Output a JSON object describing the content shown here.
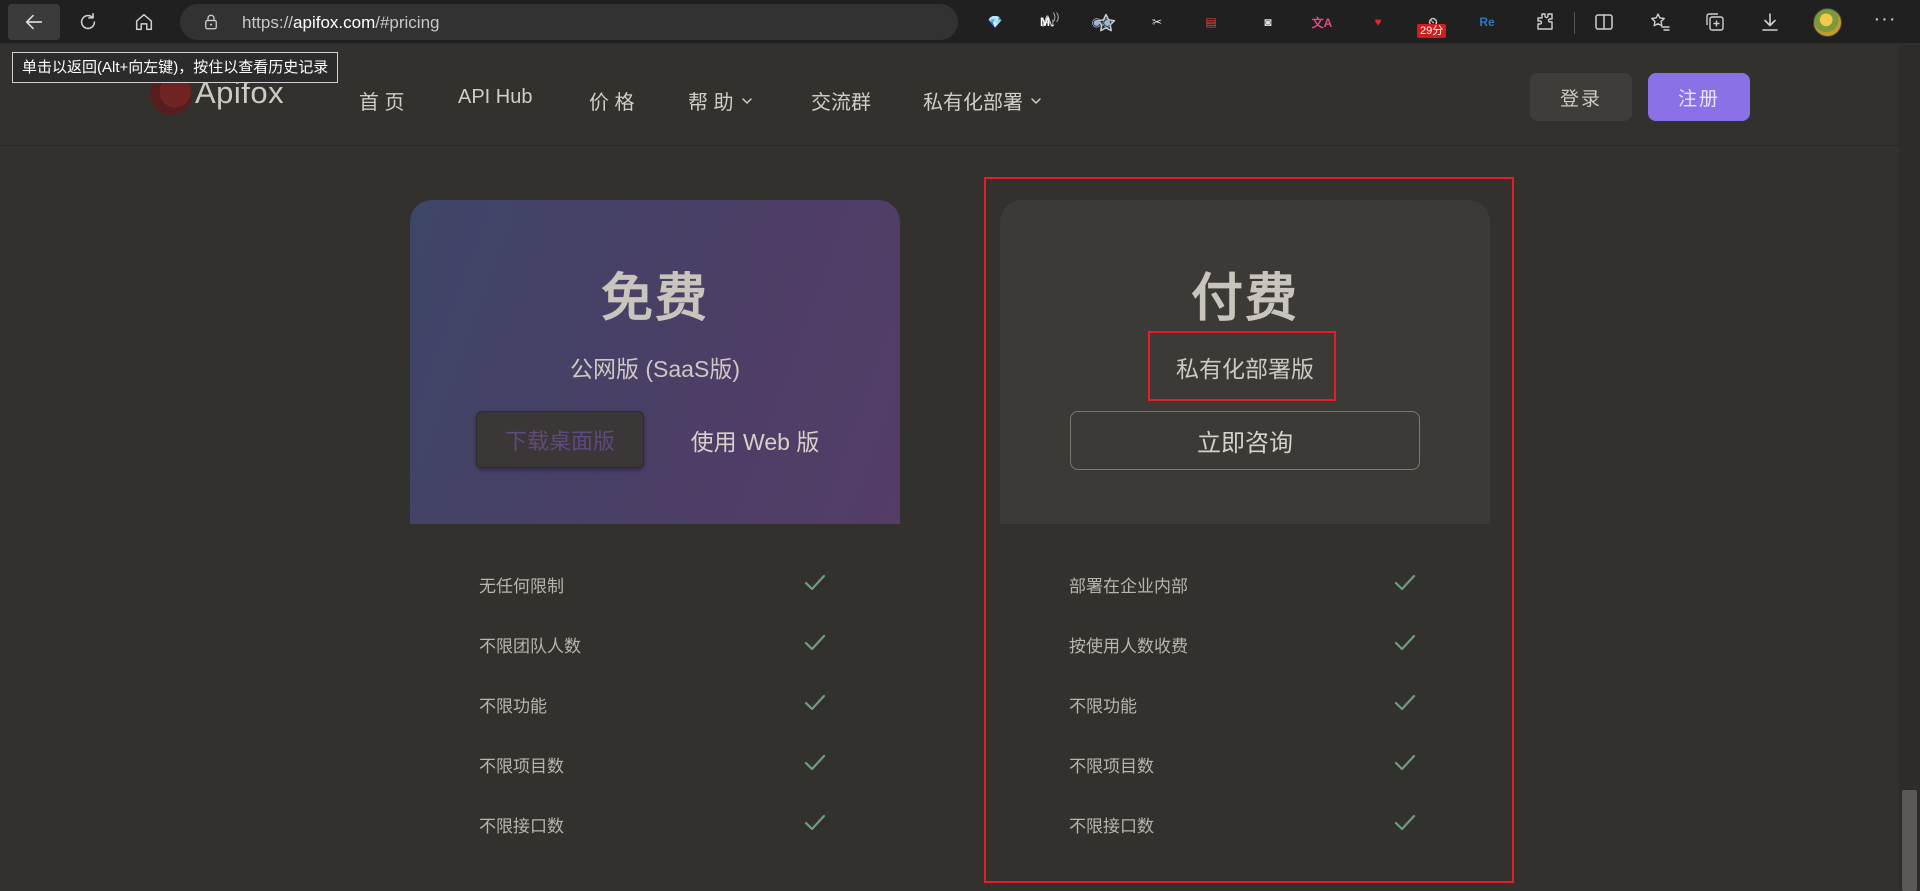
{
  "browser": {
    "url_prefix": "https://",
    "url_host": "apifox.com",
    "url_path": "/#pricing",
    "tooltip": "单击以返回(Alt+向左键)，按住以查看历史记录",
    "extensions": [
      {
        "name": "gem-extension-icon",
        "text": "💎",
        "color": "#3fa7ff"
      },
      {
        "name": "markdown-extension-icon",
        "text": "M↓",
        "color": "#ffffff"
      },
      {
        "name": "glasses-face-extension-icon",
        "text": "◉◉",
        "color": "#9fb6d6"
      },
      {
        "name": "scissors-extension-icon",
        "text": "✂",
        "color": "#e0e0e0"
      },
      {
        "name": "notes-extension-icon",
        "text": "▤",
        "color": "#e5473b"
      },
      {
        "name": "mask-extension-icon",
        "text": "◙",
        "color": "#dedede"
      },
      {
        "name": "translate-extension-icon",
        "text": "文A",
        "color": "#e24a8b"
      },
      {
        "name": "heart-shield-extension-icon",
        "text": "♥",
        "color": "#e0242c"
      },
      {
        "name": "timer-extension-icon",
        "text": "⏲",
        "color": "#c9c9c9"
      },
      {
        "name": "resume-extension-icon",
        "text": "Re",
        "color": "#2b79c2"
      }
    ],
    "timer_badge": "29分"
  },
  "header": {
    "logo_text": "Apifox",
    "nav": [
      {
        "label": "首 页"
      },
      {
        "label": "API Hub"
      },
      {
        "label": "价 格"
      },
      {
        "label": "帮 助"
      },
      {
        "label": "交流群"
      },
      {
        "label": "私有化部署"
      }
    ],
    "login_label": "登录",
    "register_label": "注册"
  },
  "free_plan": {
    "title": "免费",
    "subtitle": "公网版 (SaaS版)",
    "download_label": "下载桌面版",
    "web_label": "使用 Web 版",
    "features": [
      "无任何限制",
      "不限团队人数",
      "不限功能",
      "不限项目数",
      "不限接口数"
    ]
  },
  "paid_plan": {
    "title": "付费",
    "subtitle": "私有化部署版",
    "consult_label": "立即咨询",
    "features": [
      "部署在企业内部",
      "按使用人数收费",
      "不限功能",
      "不限项目数",
      "不限接口数"
    ]
  },
  "colors": {
    "page_bg": "#33312e",
    "accent": "#8a72e6",
    "check": "#6f9a83",
    "highlight": "#e41d2a"
  }
}
